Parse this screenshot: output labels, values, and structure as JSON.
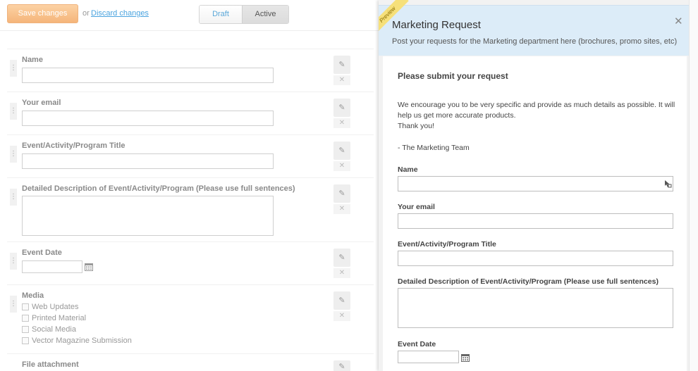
{
  "toolbar": {
    "save_label": "Save changes",
    "or_text": "or",
    "discard_label": "Discard changes",
    "status_options": [
      "Draft",
      "Active"
    ],
    "status_selected": "Active"
  },
  "editor_fields": [
    {
      "label": "Name",
      "type": "text"
    },
    {
      "label": "Your email",
      "type": "text"
    },
    {
      "label": "Event/Activity/Program Title",
      "type": "text"
    },
    {
      "label": "Detailed Description of Event/Activity/Program (Please use full sentences)",
      "type": "textarea"
    },
    {
      "label": "Event Date",
      "type": "date"
    },
    {
      "label": "Media",
      "type": "checkboxes",
      "options": [
        "Web Updates",
        "Printed Material",
        "Social Media",
        "Vector Magazine Submission"
      ]
    },
    {
      "label": "File attachment",
      "type": "file"
    }
  ],
  "icons": {
    "edit": "pencil-icon",
    "delete": "close-icon",
    "drag": "drag-handle-icon",
    "calendar": "calendar-icon"
  },
  "preview": {
    "ribbon_label": "Preview",
    "title": "Marketing Request",
    "description": "Post your requests for the Marketing department here (brochures, promo sites, etc)",
    "heading": "Please submit your request",
    "intro_line1": "We encourage you to be very specific and provide as much details as possible. It will",
    "intro_line2": "help us get more accurate products.",
    "intro_line3": "Thank you!",
    "signature": "- The Marketing Team",
    "fields": [
      {
        "label": "Name"
      },
      {
        "label": "Your email"
      },
      {
        "label": "Event/Activity/Program Title"
      },
      {
        "label": "Detailed Description of Event/Activity/Program (Please use full sentences)"
      },
      {
        "label": "Event Date"
      }
    ]
  },
  "colors": {
    "accent_orange": "#f5b57a",
    "link_blue": "#4aa3df",
    "preview_header_bg": "#dcecf8",
    "ribbon_yellow": "#f6e07a"
  }
}
